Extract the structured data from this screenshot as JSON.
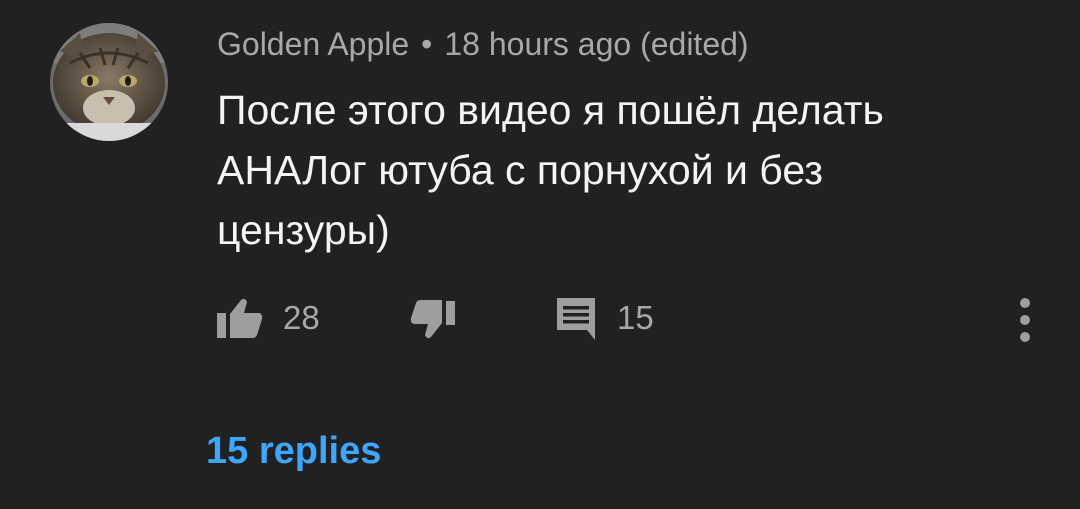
{
  "comment": {
    "author": "Golden Apple",
    "separator": "•",
    "timestamp": "18 hours ago (edited)",
    "text": "После этого видео я пошёл делать АНАЛог ютуба с порнухой и без цензуры)",
    "avatar_icon": "cat-avatar",
    "actions": {
      "like_icon": "thumbs-up-icon",
      "like_count": "28",
      "dislike_icon": "thumbs-down-icon",
      "reply_icon": "comment-icon",
      "reply_count": "15",
      "more_icon": "more-vertical-icon"
    },
    "replies_label": "15 replies"
  },
  "colors": {
    "background": "#212121",
    "meta_text": "#a8a8a8",
    "body_text": "#f4f4f4",
    "icon": "#9e9e9e",
    "link": "#3ea6ff"
  }
}
